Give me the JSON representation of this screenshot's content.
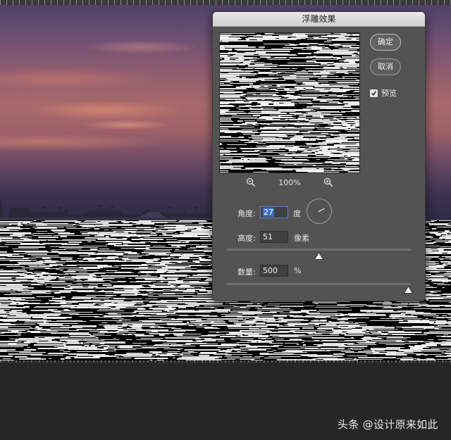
{
  "dialog": {
    "title": "浮雕效果",
    "ok_label": "确定",
    "cancel_label": "取消",
    "preview_label": "预览",
    "preview_checked": true,
    "zoom_level": "100%"
  },
  "params": {
    "angle_label": "角度:",
    "angle_value": "27",
    "angle_unit": "度",
    "height_label": "高度:",
    "height_value": "51",
    "height_unit": "像素",
    "amount_label": "数量:",
    "amount_value": "500",
    "amount_unit": "%",
    "height_slider_fraction": 0.5,
    "amount_slider_fraction": 1.0
  },
  "watermark": "头条 @设计原来如此",
  "icons": [
    "zoom-out-icon",
    "zoom-in-icon",
    "checkmark-icon",
    "angle-dial-icon",
    "slider-thumb-icon"
  ],
  "colors": {
    "dialog_bg": "#535353",
    "field_bg": "#404040",
    "selection": "#3d6ec6",
    "workspace": "#262626"
  }
}
